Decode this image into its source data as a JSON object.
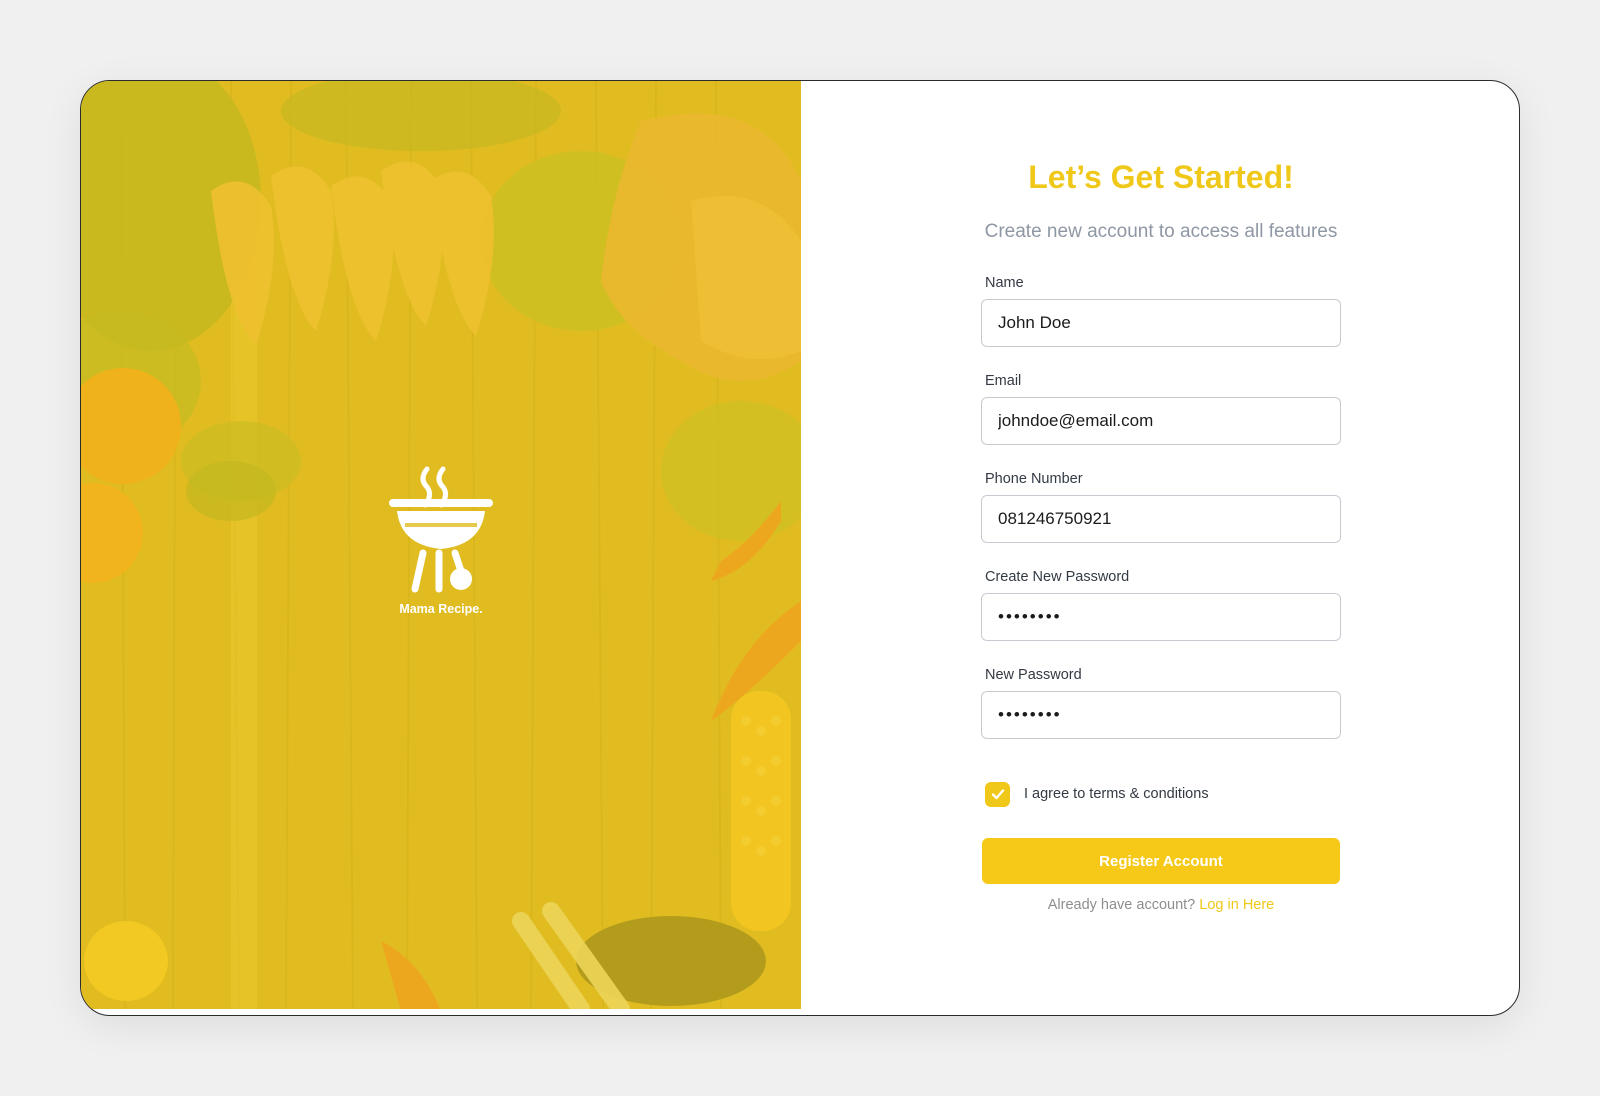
{
  "brand": {
    "name": "Mama Recipe.",
    "logo_icon": "grill-icon",
    "accent_color": "#efc81a"
  },
  "hero": {
    "background": "food-ingredients-on-wooden-table"
  },
  "form": {
    "title": "Let’s Get Started!",
    "subtitle": "Create new account to access all features",
    "fields": {
      "name": {
        "label": "Name",
        "value": "John Doe"
      },
      "email": {
        "label": "Email",
        "value": "johndoe@email.com"
      },
      "phone": {
        "label": "Phone Number",
        "value": "081246750921"
      },
      "create_password": {
        "label": "Create New Password",
        "value": "••••••••"
      },
      "new_password": {
        "label": "New Password",
        "value": "••••••••"
      }
    },
    "terms": {
      "label": "I agree to terms & conditions",
      "checked": true
    },
    "submit_label": "Register Account",
    "login_prompt": "Already have account?",
    "login_link": "Log in Here"
  }
}
